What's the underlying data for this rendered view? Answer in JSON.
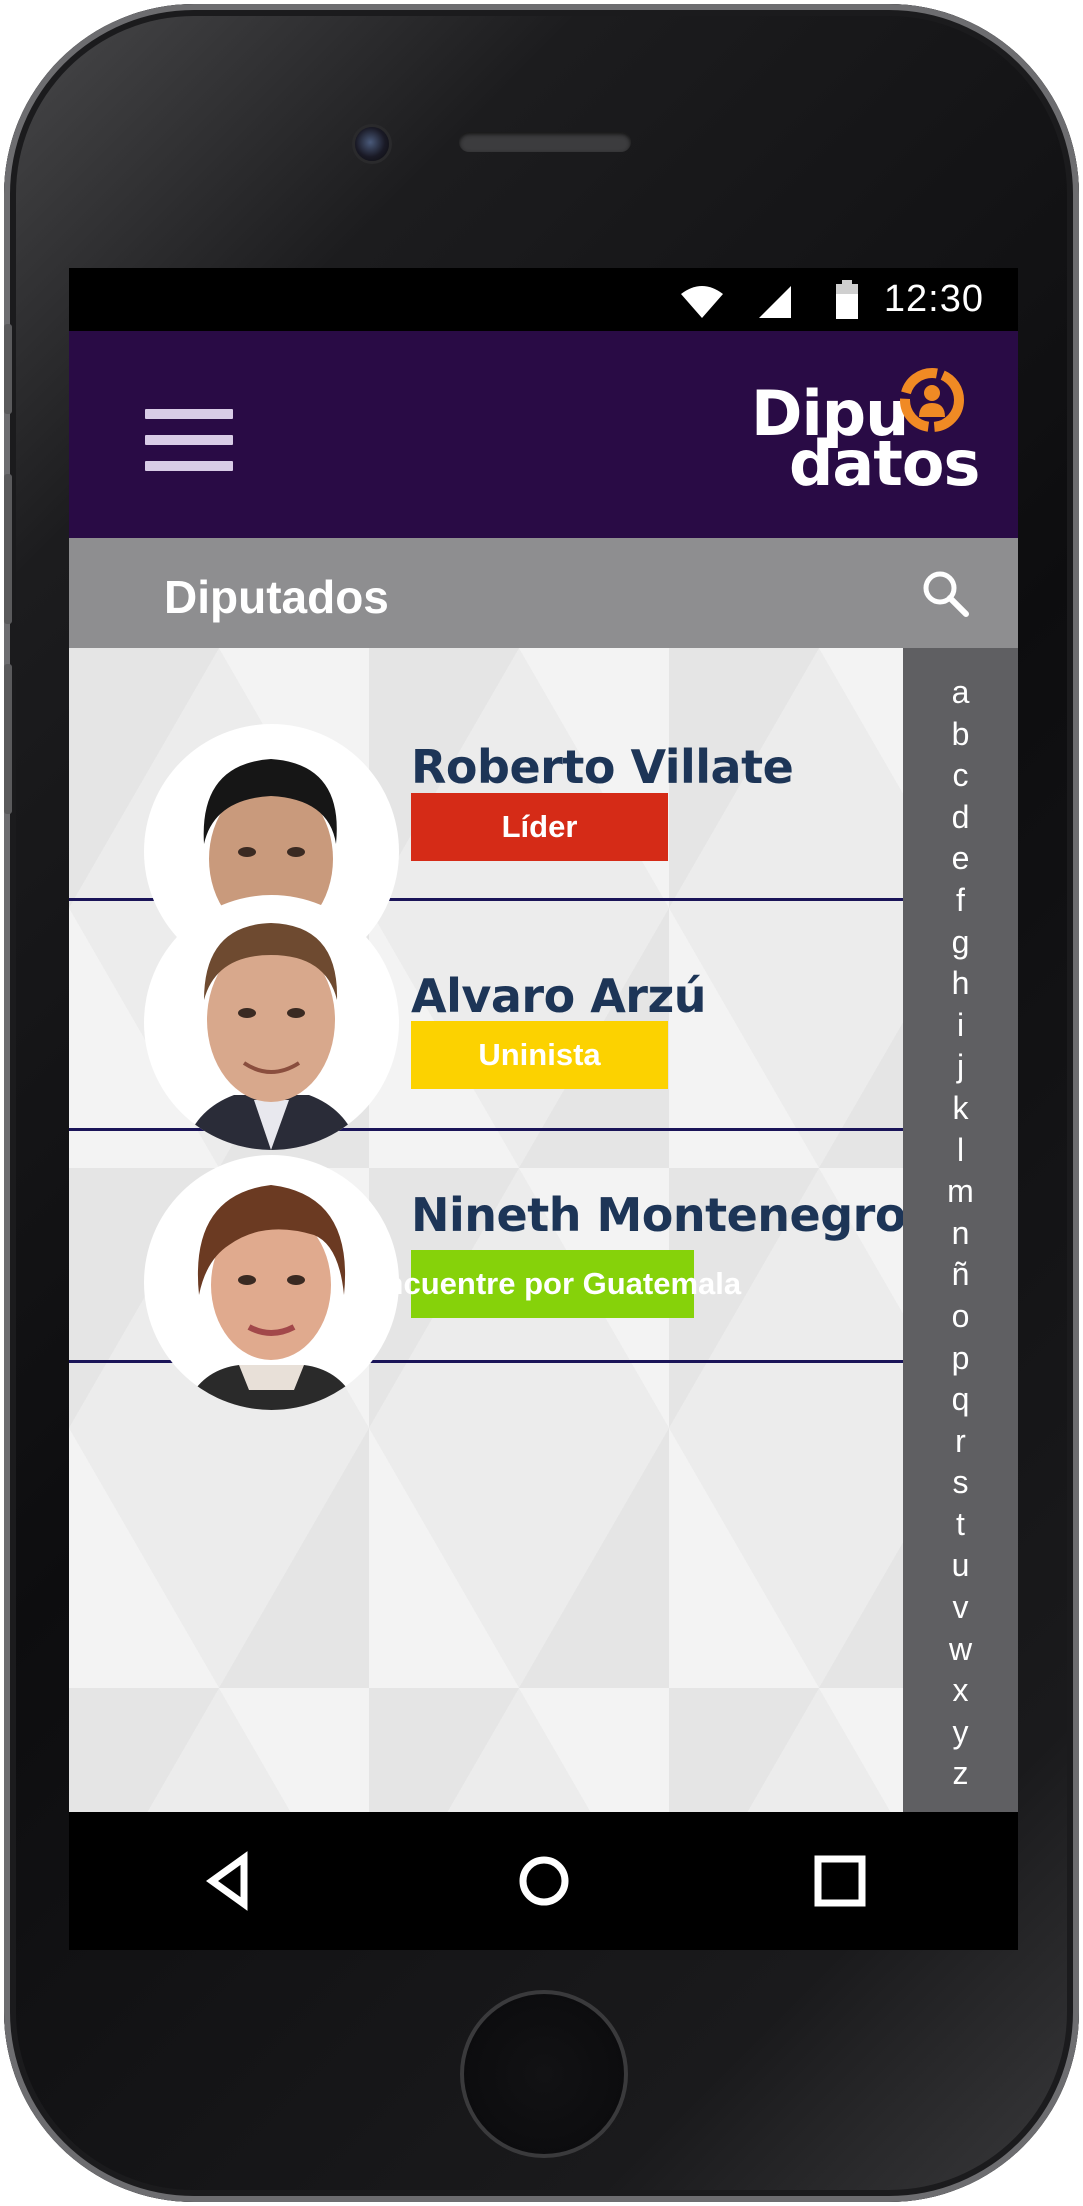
{
  "status_bar": {
    "time": "12:30",
    "icons": [
      "wifi-icon",
      "signal-icon",
      "battery-icon"
    ]
  },
  "header": {
    "logo_line1": "Dipu",
    "logo_line2": "datos",
    "menu_icon": "hamburger-menu-icon",
    "background_color": "#290b45",
    "logo_accent_color": "#f08a24"
  },
  "title_bar": {
    "title": "Diputados",
    "search_icon": "search-icon"
  },
  "deputies": [
    {
      "name": "Roberto Villate",
      "party": "Líder",
      "party_color": "#d52b17"
    },
    {
      "name": "Alvaro Arzú",
      "party": "Uninista",
      "party_color": "#fcd200"
    },
    {
      "name": "Nineth Montenegro",
      "party": "Encuentre por Guatemala",
      "party_color": "#86d20a"
    }
  ],
  "alphabet": [
    "a",
    "b",
    "c",
    "d",
    "e",
    "f",
    "g",
    "h",
    "i",
    "j",
    "k",
    "l",
    "m",
    "n",
    "ñ",
    "o",
    "p",
    "q",
    "r",
    "s",
    "t",
    "u",
    "v",
    "w",
    "x",
    "y",
    "z"
  ],
  "nav_bar": {
    "buttons": [
      "back-icon",
      "home-icon",
      "recents-icon"
    ]
  }
}
